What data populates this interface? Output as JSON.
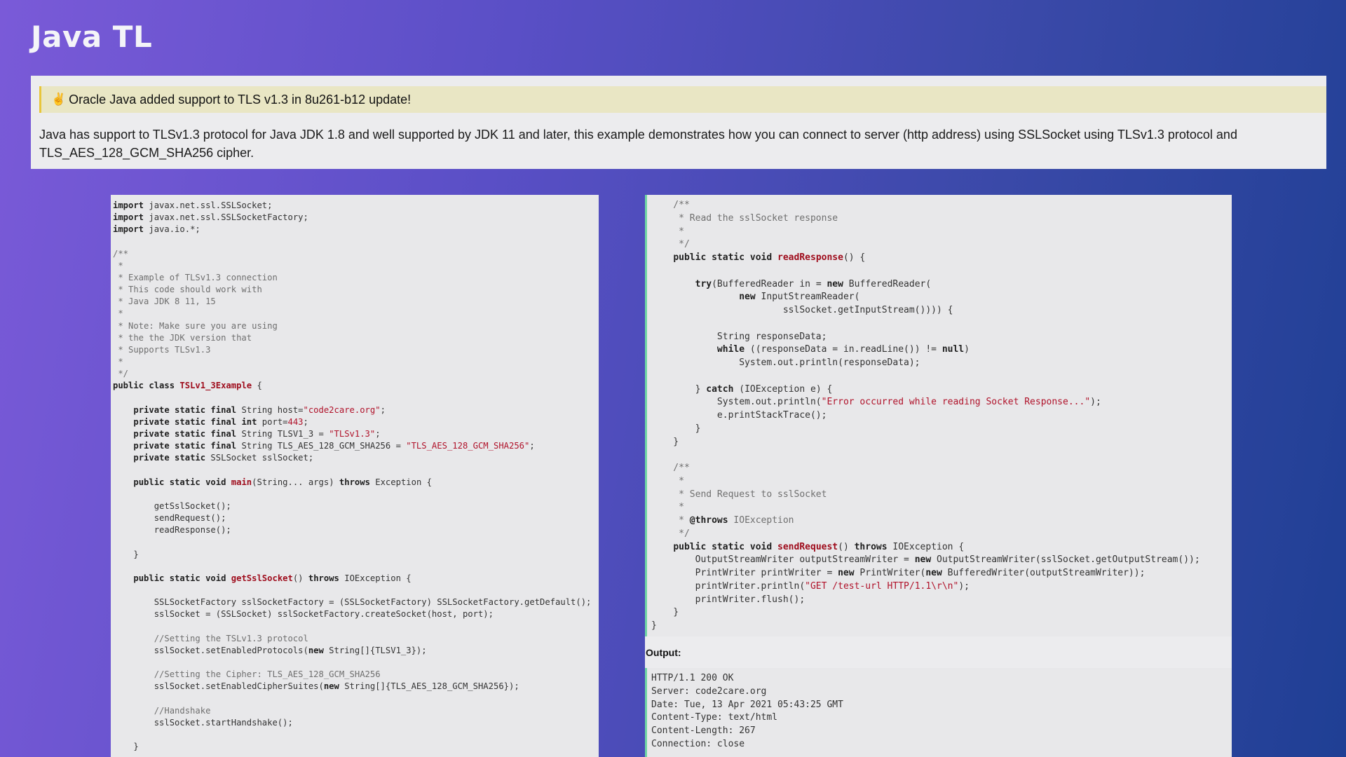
{
  "page": {
    "title": "Java TL"
  },
  "intro": {
    "note_icon": "victory-hand-emoji",
    "note_icon_glyph": "✌️",
    "note_text": "Oracle Java added support to TLS v1.3 in 8u261-b12 update!",
    "description": "Java has support to TLSv1.3 protocol for Java JDK 1.8 and well supported by JDK 11 and later, this example demonstrates how you can connect to server (http address) using SSLSocket using TLSv1.3 protocol and TLS_AES_128_GCM_SHA256 cipher."
  },
  "colors": {
    "keyword": "#1f1f1f",
    "string": "#b0122a",
    "function_name": "#9e0b1b",
    "comment": "#6f6f6f",
    "note_background": "#e9e6c4",
    "note_border": "#e8c63a",
    "code_border_accent": "#6fd6a4"
  },
  "code_left": {
    "lines": [
      [
        [
          "k",
          "import"
        ],
        [
          "p",
          " javax.net.ssl.SSLSocket;"
        ]
      ],
      [
        [
          "k",
          "import"
        ],
        [
          "p",
          " javax.net.ssl.SSLSocketFactory;"
        ]
      ],
      [
        [
          "k",
          "import"
        ],
        [
          "p",
          " java.io.*;"
        ]
      ],
      [],
      [
        [
          "c",
          "/**"
        ]
      ],
      [
        [
          "c",
          " *"
        ]
      ],
      [
        [
          "c",
          " * Example of TLSv1.3 connection"
        ]
      ],
      [
        [
          "c",
          " * This code should work with"
        ]
      ],
      [
        [
          "c",
          " * Java JDK 8 11, 15"
        ]
      ],
      [
        [
          "c",
          " *"
        ]
      ],
      [
        [
          "c",
          " * Note: Make sure you are using"
        ]
      ],
      [
        [
          "c",
          " * the the JDK version that"
        ]
      ],
      [
        [
          "c",
          " * Supports TLSv1.3"
        ]
      ],
      [
        [
          "c",
          " *"
        ]
      ],
      [
        [
          "c",
          " */"
        ]
      ],
      [
        [
          "k",
          "public class "
        ],
        [
          "f",
          "TSLv1_3Example"
        ],
        [
          "p",
          " {"
        ]
      ],
      [],
      [
        [
          "p",
          "    "
        ],
        [
          "k",
          "private static final"
        ],
        [
          "p",
          " String host="
        ],
        [
          "s",
          "\"code2care.org\""
        ],
        [
          "p",
          ";"
        ]
      ],
      [
        [
          "p",
          "    "
        ],
        [
          "k",
          "private static final int"
        ],
        [
          "p",
          " port="
        ],
        [
          "s",
          "443"
        ],
        [
          "p",
          ";"
        ]
      ],
      [
        [
          "p",
          "    "
        ],
        [
          "k",
          "private static final"
        ],
        [
          "p",
          " String TLSV1_3 = "
        ],
        [
          "s",
          "\"TLSv1.3\""
        ],
        [
          "p",
          ";"
        ]
      ],
      [
        [
          "p",
          "    "
        ],
        [
          "k",
          "private static final"
        ],
        [
          "p",
          " String TLS_AES_128_GCM_SHA256 = "
        ],
        [
          "s",
          "\"TLS_AES_128_GCM_SHA256\""
        ],
        [
          "p",
          ";"
        ]
      ],
      [
        [
          "p",
          "    "
        ],
        [
          "k",
          "private static"
        ],
        [
          "p",
          " SSLSocket sslSocket;"
        ]
      ],
      [],
      [
        [
          "p",
          "    "
        ],
        [
          "k",
          "public static void "
        ],
        [
          "f",
          "main"
        ],
        [
          "p",
          "(String... args) "
        ],
        [
          "k",
          "throws"
        ],
        [
          "p",
          " Exception {"
        ]
      ],
      [],
      [
        [
          "p",
          "        getSslSocket();"
        ]
      ],
      [
        [
          "p",
          "        sendRequest();"
        ]
      ],
      [
        [
          "p",
          "        readResponse();"
        ]
      ],
      [],
      [
        [
          "p",
          "    }"
        ]
      ],
      [],
      [
        [
          "p",
          "    "
        ],
        [
          "k",
          "public static void "
        ],
        [
          "f",
          "getSslSocket"
        ],
        [
          "p",
          "() "
        ],
        [
          "k",
          "throws"
        ],
        [
          "p",
          " IOException {"
        ]
      ],
      [],
      [
        [
          "p",
          "        SSLSocketFactory sslSocketFactory = (SSLSocketFactory) SSLSocketFactory.getDefault();"
        ]
      ],
      [
        [
          "p",
          "        sslSocket = (SSLSocket) sslSocketFactory.createSocket(host, port);"
        ]
      ],
      [],
      [
        [
          "c",
          "        //Setting the TSLv1.3 protocol"
        ]
      ],
      [
        [
          "p",
          "        sslSocket.setEnabledProtocols("
        ],
        [
          "k",
          "new"
        ],
        [
          "p",
          " String[]{TLSV1_3});"
        ]
      ],
      [],
      [
        [
          "c",
          "        //Setting the Cipher: TLS_AES_128_GCM_SHA256"
        ]
      ],
      [
        [
          "p",
          "        sslSocket.setEnabledCipherSuites("
        ],
        [
          "k",
          "new"
        ],
        [
          "p",
          " String[]{TLS_AES_128_GCM_SHA256});"
        ]
      ],
      [],
      [
        [
          "c",
          "        //Handshake"
        ]
      ],
      [
        [
          "p",
          "        sslSocket.startHandshake();"
        ]
      ],
      [],
      [
        [
          "p",
          "    }"
        ]
      ]
    ]
  },
  "code_right": {
    "lines": [
      [
        [
          "c",
          "    /**"
        ]
      ],
      [
        [
          "c",
          "     * Read the sslSocket response"
        ]
      ],
      [
        [
          "c",
          "     *"
        ]
      ],
      [
        [
          "c",
          "     */"
        ]
      ],
      [
        [
          "p",
          "    "
        ],
        [
          "k",
          "public static void "
        ],
        [
          "f",
          "readResponse"
        ],
        [
          "p",
          "() {"
        ]
      ],
      [],
      [
        [
          "p",
          "        "
        ],
        [
          "k",
          "try"
        ],
        [
          "p",
          "(BufferedReader in = "
        ],
        [
          "k",
          "new"
        ],
        [
          "p",
          " BufferedReader("
        ]
      ],
      [
        [
          "p",
          "                "
        ],
        [
          "k",
          "new"
        ],
        [
          "p",
          " InputStreamReader("
        ]
      ],
      [
        [
          "p",
          "                        sslSocket.getInputStream()))) {"
        ]
      ],
      [],
      [
        [
          "p",
          "            String responseData;"
        ]
      ],
      [
        [
          "p",
          "            "
        ],
        [
          "k",
          "while"
        ],
        [
          "p",
          " ((responseData = in.readLine()) != "
        ],
        [
          "k",
          "null"
        ],
        [
          "p",
          ")"
        ]
      ],
      [
        [
          "p",
          "                System.out.println(responseData);"
        ]
      ],
      [],
      [
        [
          "p",
          "        } "
        ],
        [
          "k",
          "catch"
        ],
        [
          "p",
          " (IOException e) {"
        ]
      ],
      [
        [
          "p",
          "            System.out.println("
        ],
        [
          "s",
          "\"Error occurred while reading Socket Response...\""
        ],
        [
          "p",
          ");"
        ]
      ],
      [
        [
          "p",
          "            e.printStackTrace();"
        ]
      ],
      [
        [
          "p",
          "        }"
        ]
      ],
      [
        [
          "p",
          "    }"
        ]
      ],
      [],
      [
        [
          "c",
          "    /**"
        ]
      ],
      [
        [
          "c",
          "     *"
        ]
      ],
      [
        [
          "c",
          "     * Send Request to sslSocket"
        ]
      ],
      [
        [
          "c",
          "     *"
        ]
      ],
      [
        [
          "c",
          "     * "
        ],
        [
          "k",
          "@throws"
        ],
        [
          "c",
          " IOException"
        ]
      ],
      [
        [
          "c",
          "     */"
        ]
      ],
      [
        [
          "p",
          "    "
        ],
        [
          "k",
          "public static void "
        ],
        [
          "f",
          "sendRequest"
        ],
        [
          "p",
          "() "
        ],
        [
          "k",
          "throws"
        ],
        [
          "p",
          " IOException {"
        ]
      ],
      [
        [
          "p",
          "        OutputStreamWriter outputStreamWriter = "
        ],
        [
          "k",
          "new"
        ],
        [
          "p",
          " OutputStreamWriter(sslSocket.getOutputStream());"
        ]
      ],
      [
        [
          "p",
          "        PrintWriter printWriter = "
        ],
        [
          "k",
          "new"
        ],
        [
          "p",
          " PrintWriter("
        ],
        [
          "k",
          "new"
        ],
        [
          "p",
          " BufferedWriter(outputStreamWriter));"
        ]
      ],
      [
        [
          "p",
          "        printWriter.println("
        ],
        [
          "s",
          "\"GET /test-url HTTP/1.1\\r\\n\""
        ],
        [
          "p",
          ");"
        ]
      ],
      [
        [
          "p",
          "        printWriter.flush();"
        ]
      ],
      [
        [
          "p",
          "    }"
        ]
      ],
      [
        [
          "p",
          "}"
        ]
      ]
    ]
  },
  "output": {
    "label": "Output:",
    "lines": [
      "HTTP/1.1 200 OK",
      "Server: code2care.org",
      "Date: Tue, 13 Apr 2021 05:43:25 GMT",
      "Content-Type: text/html",
      "Content-Length: 267",
      "Connection: close"
    ]
  }
}
